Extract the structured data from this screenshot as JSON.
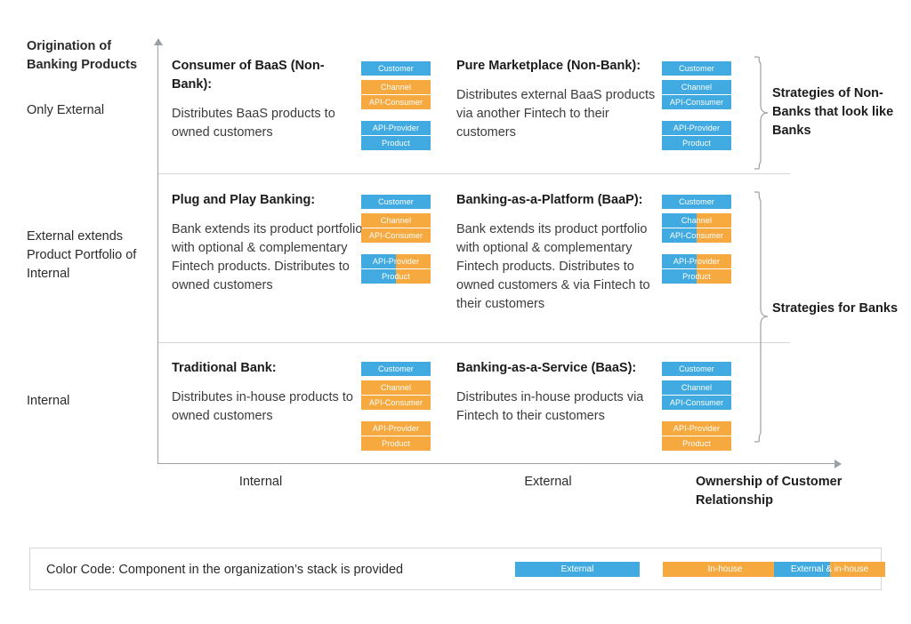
{
  "colors": {
    "external": "#41ABE1",
    "inhouse": "#F5A93F",
    "axis": "#9aa0a6",
    "divider": "#d4d7da",
    "text": "#2b2b2b"
  },
  "y_axis": {
    "title": "Origination of Banking Products",
    "labels": {
      "top": "Only External",
      "middle": "External extends Product Portfolio of Internal",
      "bottom": "Internal"
    }
  },
  "x_axis": {
    "title": "Ownership of Customer Relationship",
    "ticks": [
      "Internal",
      "External"
    ]
  },
  "stack_layers": {
    "customer": "Customer",
    "channel": "Channel",
    "api_consumer": "API-Consumer",
    "api_provider": "API-Provider",
    "product": "Product"
  },
  "cells": [
    {
      "id": "consumer-of-baas",
      "title": "Consumer of BaaS (Non-Bank):",
      "description": "Distributes BaaS products to owned customers",
      "stack": {
        "customer": "external",
        "channel": "inhouse",
        "api_consumer": "inhouse",
        "api_provider": "external",
        "product": "external"
      }
    },
    {
      "id": "pure-marketplace",
      "title": "Pure Marketplace (Non-Bank):",
      "description": "Distributes external BaaS products via another Fintech to their customers",
      "stack": {
        "customer": "external",
        "channel": "external",
        "api_consumer": "external",
        "api_provider": "external",
        "product": "external"
      }
    },
    {
      "id": "plug-and-play-banking",
      "title": "Plug and Play Banking:",
      "description": "Bank extends its product portfolio with optional & complementary Fintech products. Distributes to owned customers",
      "stack": {
        "customer": "external",
        "channel": "inhouse",
        "api_consumer": "inhouse",
        "api_provider": "both",
        "product": "both"
      }
    },
    {
      "id": "banking-as-a-platform",
      "title": "Banking-as-a-Platform (BaaP):",
      "description": "Bank extends its product portfolio with optional & complementary Fintech products. Distributes to owned customers & via Fintech to their customers",
      "stack": {
        "customer": "external",
        "channel": "both",
        "api_consumer": "both",
        "api_provider": "both",
        "product": "both"
      }
    },
    {
      "id": "traditional-bank",
      "title": "Traditional Bank:",
      "description": "Distributes in-house products to owned customers",
      "stack": {
        "customer": "external",
        "channel": "inhouse",
        "api_consumer": "inhouse",
        "api_provider": "inhouse",
        "product": "inhouse"
      }
    },
    {
      "id": "banking-as-a-service",
      "title": "Banking-as-a-Service (BaaS):",
      "description": "Distributes in-house products via Fintech to their customers",
      "stack": {
        "customer": "external",
        "channel": "external",
        "api_consumer": "external",
        "api_provider": "inhouse",
        "product": "inhouse"
      }
    }
  ],
  "braces": {
    "non_banks": "Strategies of Non-Banks that look like Banks",
    "banks": "Strategies for Banks"
  },
  "legend": {
    "caption": "Color Code: Component in the organization’s stack is provided",
    "items": [
      {
        "label": "External",
        "kind": "external"
      },
      {
        "label": "In-house",
        "kind": "inhouse"
      },
      {
        "label": "External & in-house",
        "kind": "both"
      }
    ]
  }
}
